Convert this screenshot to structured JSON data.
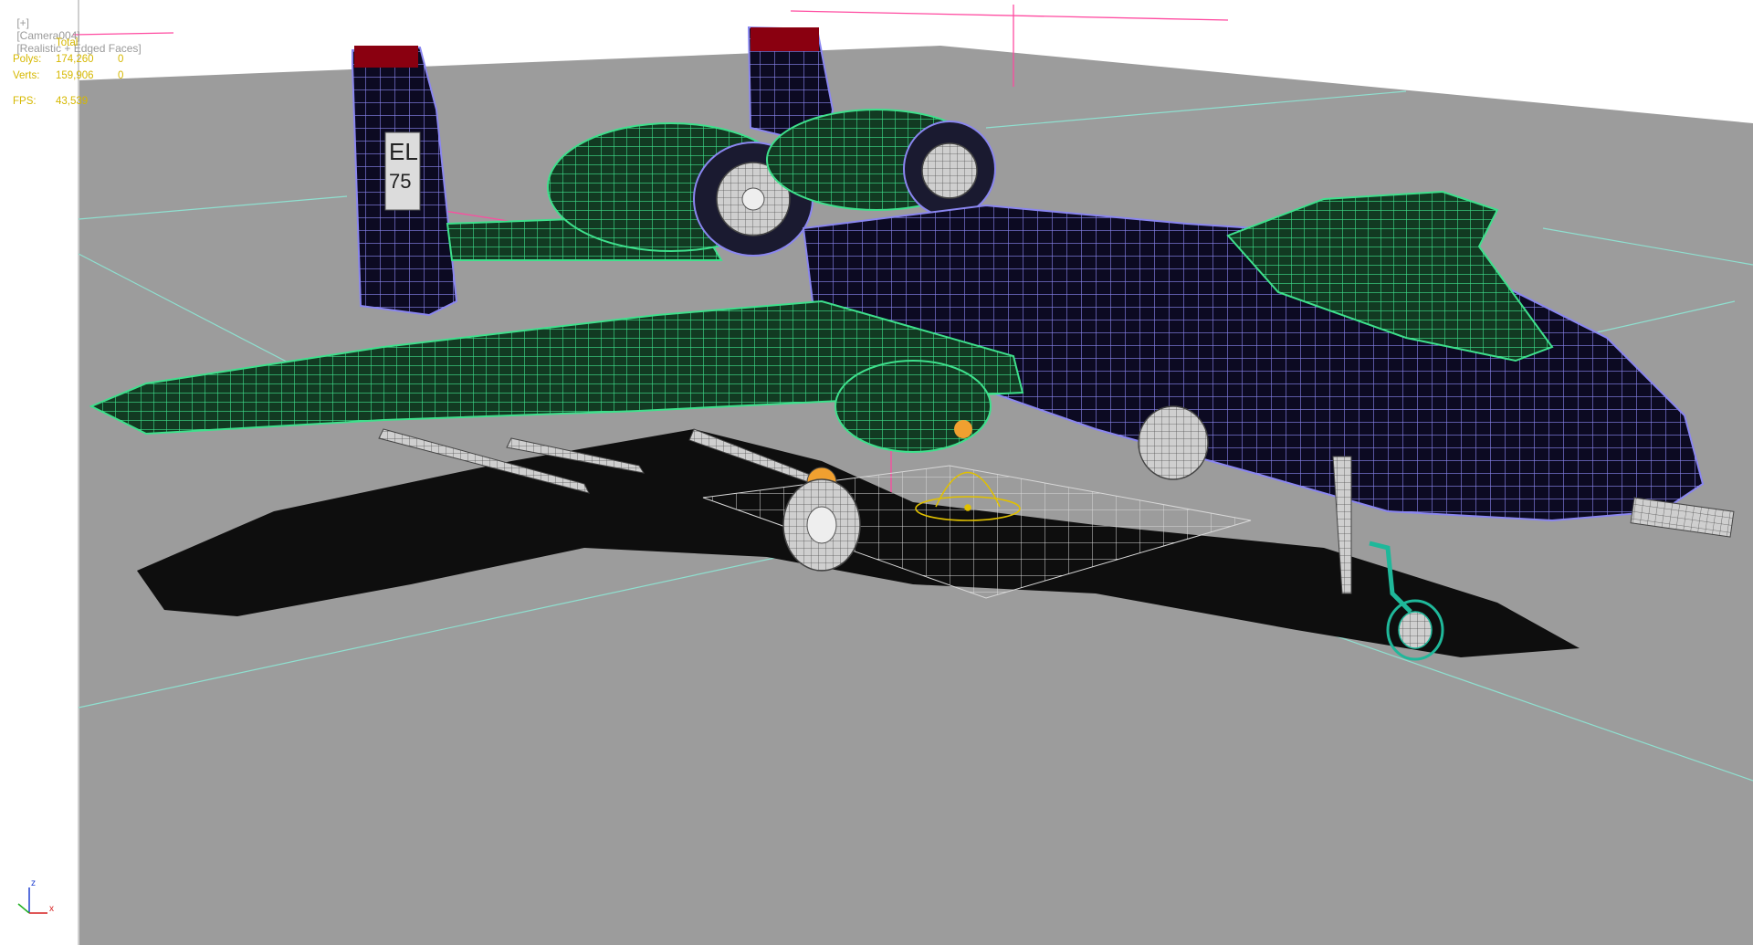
{
  "viewport": {
    "label_parts": [
      "[+]",
      "[Camera004]",
      "[Realistic + Edged Faces]"
    ]
  },
  "stats": {
    "header": "Total",
    "polys_label": "Polys:",
    "polys_value": "174,260",
    "polys_sel": "0",
    "verts_label": "Verts:",
    "verts_value": "159,906",
    "verts_sel": "0",
    "fps_label": "FPS:",
    "fps_value": "43,539"
  },
  "axis_gizmo": {
    "z_label": "z",
    "x_label": "x",
    "colors": {
      "x": "#d62020",
      "y": "#20b020",
      "z": "#2040d0"
    }
  },
  "scene": {
    "background_color": "#ffffff",
    "ground_color": "#9c9c9c",
    "shadow_color": "#111111",
    "fuselage_color": "#0c0a22",
    "fuselage_wire_color": "#8a86f0",
    "wing_wire_color": "#3ee08c",
    "selected_wire_color": "#1fb89a",
    "pivot_color": "#e0c000",
    "grid_color": "#d8d8d8",
    "guide_color": "#8fe0d0",
    "camera_line_color": "#ff4aa0",
    "tail_code": "EL 75"
  }
}
